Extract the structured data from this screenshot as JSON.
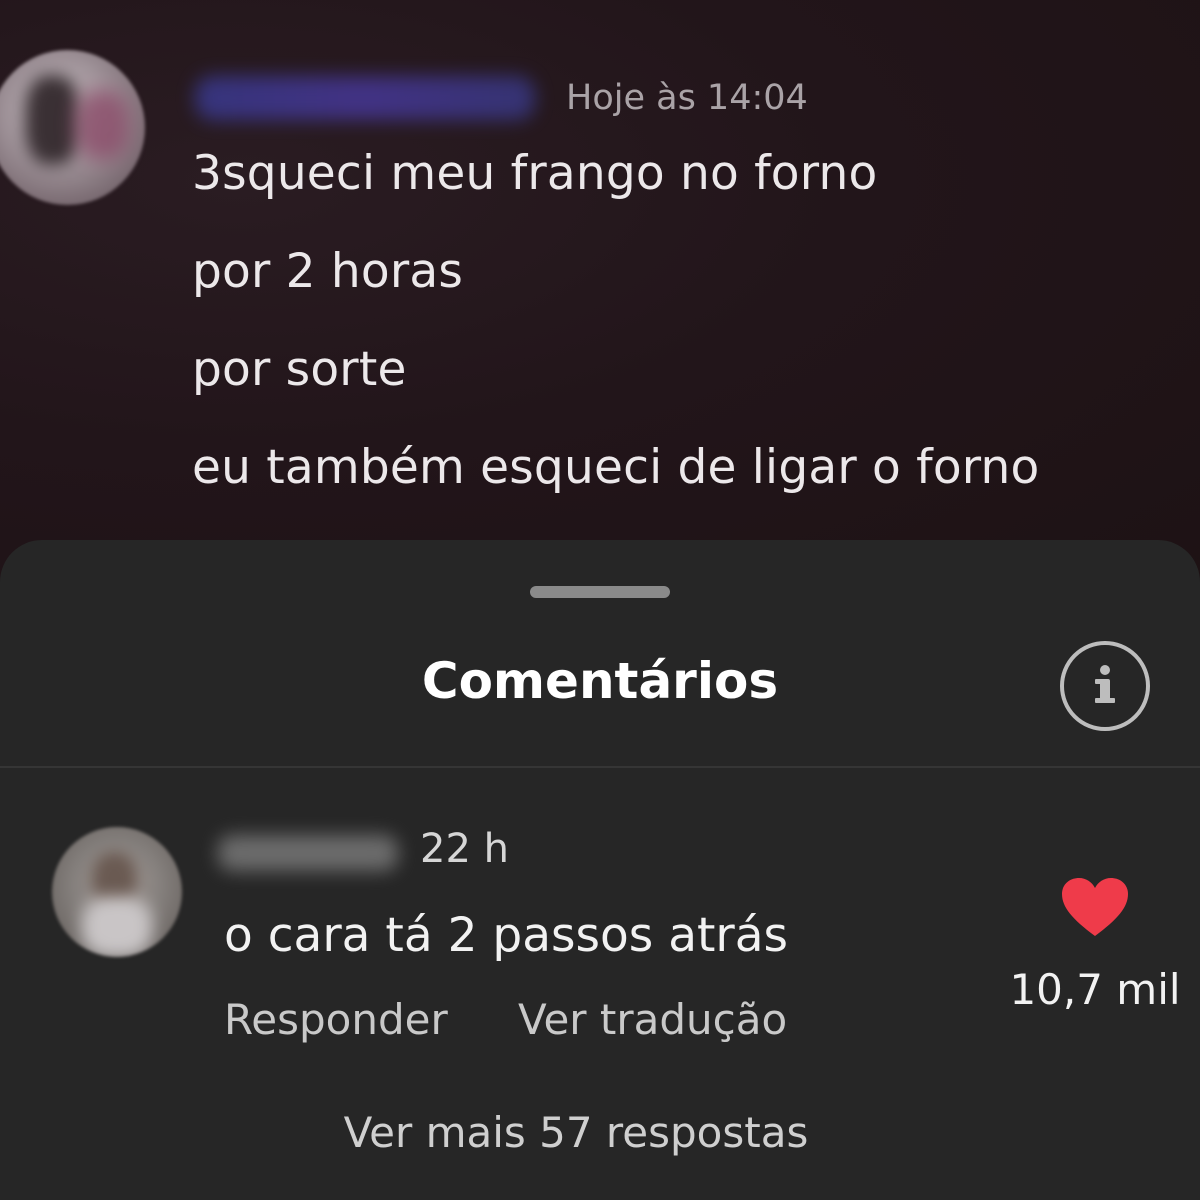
{
  "message": {
    "timestamp": "Hoje às 14:04",
    "lines": [
      "3squeci meu frango no forno",
      "por 2 horas",
      "por sorte",
      "eu também esqueci de ligar o forno"
    ]
  },
  "comments_sheet": {
    "title": "Comentários",
    "info_icon": "info-icon",
    "comment": {
      "time": "22 h",
      "text": "o cara tá 2 passos atrás",
      "reply_label": "Responder",
      "translate_label": "Ver tradução",
      "like_icon": "heart-icon",
      "like_count": "10,7 mil"
    },
    "more_replies_label": "Ver mais 57 respostas"
  },
  "colors": {
    "sheet_background": "#262626",
    "heart": "#ef3b4a"
  }
}
